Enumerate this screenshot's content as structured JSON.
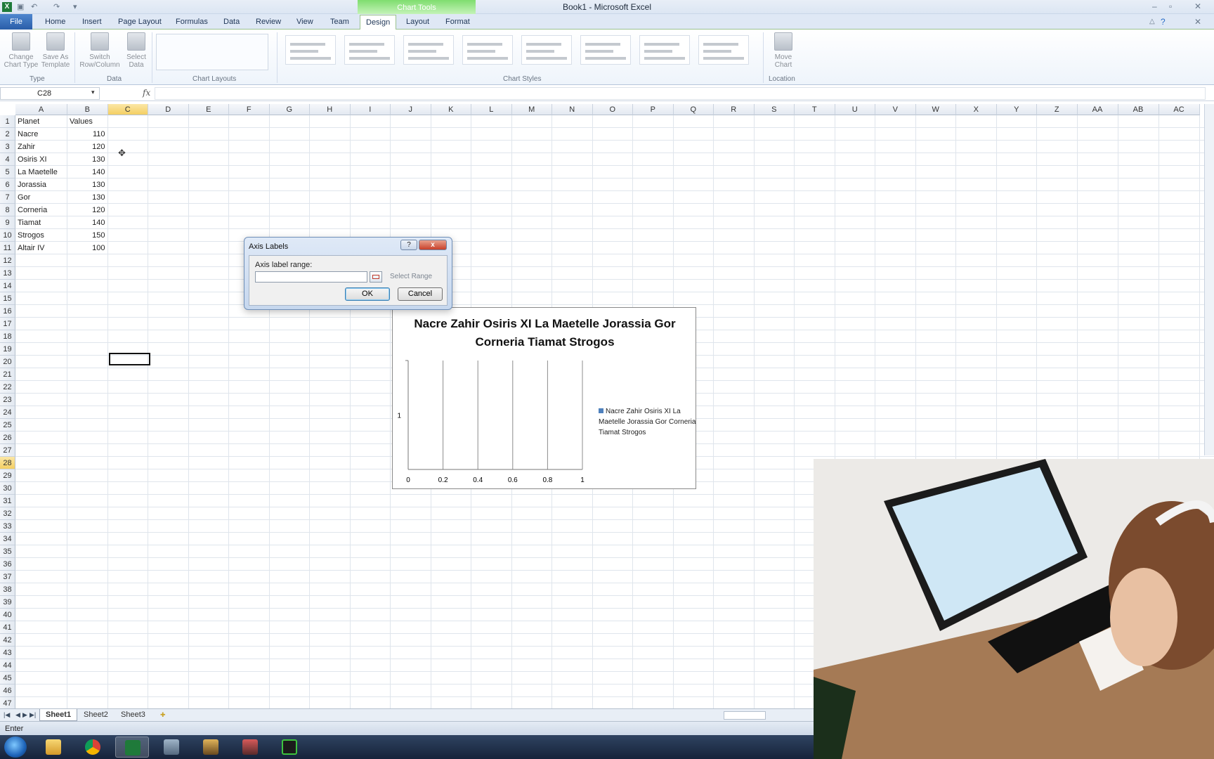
{
  "window": {
    "title": "Book1 - Microsoft Excel",
    "app_icon": "X"
  },
  "ribbon": {
    "contextual_group": "Chart Tools",
    "tabs": [
      "File",
      "Home",
      "Insert",
      "Page Layout",
      "Formulas",
      "Data",
      "Review",
      "View",
      "Team",
      "Design",
      "Layout",
      "Format"
    ],
    "active_tab": "Design",
    "buttons": {
      "change_chart_type": "Change Chart Type",
      "save_as_template": "Save As Template",
      "switch_row_column": "Switch Row/Column",
      "select_data": "Select Data",
      "move_chart": "Move Chart"
    },
    "groups": {
      "type": "Type",
      "data": "Data",
      "chart_layouts": "Chart Layouts",
      "chart_styles": "Chart Styles",
      "location": "Location"
    }
  },
  "formula_bar": {
    "name_box": "C28",
    "fx": "fx",
    "formula": ""
  },
  "columns": [
    "A",
    "B",
    "C",
    "D",
    "E",
    "F",
    "G",
    "H",
    "I",
    "J",
    "K",
    "L",
    "M",
    "N",
    "O",
    "P",
    "Q",
    "R",
    "S",
    "T",
    "U",
    "V",
    "W",
    "X",
    "Y",
    "Z",
    "AA",
    "AB",
    "AC"
  ],
  "selected_column": "C",
  "selected_row": 28,
  "sheet": {
    "header": {
      "planet": "Planet",
      "values": "Values"
    },
    "rows": [
      {
        "planet": "Nacre",
        "value": "110"
      },
      {
        "planet": "Zahir",
        "value": "120"
      },
      {
        "planet": "Osiris XI",
        "value": "130"
      },
      {
        "planet": "La Maetelle",
        "value": "140"
      },
      {
        "planet": "Jorassia",
        "value": "130"
      },
      {
        "planet": "Gor",
        "value": "130"
      },
      {
        "planet": "Corneria",
        "value": "120"
      },
      {
        "planet": "Tiamat",
        "value": "140"
      },
      {
        "planet": "Strogos",
        "value": "150"
      },
      {
        "planet": "Altair IV",
        "value": "100"
      }
    ]
  },
  "chart_data": {
    "type": "bar",
    "title": "Nacre Zahir Osiris XI La Maetelle Jorassia Gor Corneria Tiamat Strogos",
    "categories": [
      "1"
    ],
    "series": [
      {
        "name": "Nacre Zahir Osiris XI La Maetelle Jorassia Gor Corneria Tiamat Strogos",
        "values": [
          0
        ]
      }
    ],
    "x_ticks": [
      "0",
      "0.2",
      "0.4",
      "0.6",
      "0.8",
      "1"
    ],
    "xlim": [
      0,
      1
    ],
    "grid": true,
    "legend_position": "right",
    "series_color": "#4f81bd"
  },
  "dialog": {
    "title": "Axis Labels",
    "help": "?",
    "close": "x",
    "label": "Axis label range:",
    "value": "",
    "select_range": "Select Range",
    "ok": "OK",
    "cancel": "Cancel"
  },
  "sheet_tabs": [
    "Sheet1",
    "Sheet2",
    "Sheet3"
  ],
  "active_sheet": "Sheet1",
  "status": "Enter"
}
